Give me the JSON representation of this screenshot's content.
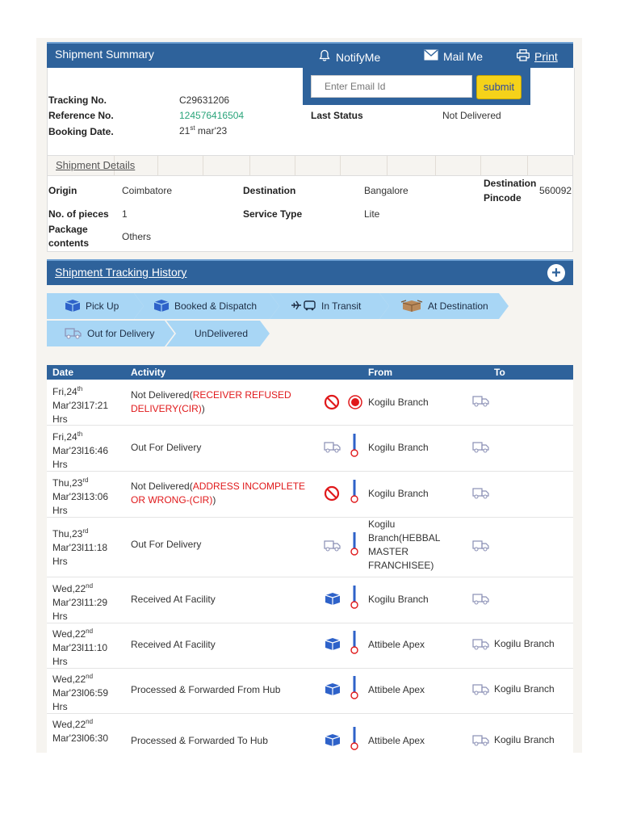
{
  "header": {
    "title": "Shipment Summary",
    "notify_label": "NotifyMe",
    "mail_label": "Mail Me",
    "print_label": "Print"
  },
  "email_popup": {
    "placeholder": "Enter Email Id",
    "submit_label": "submit"
  },
  "summary": {
    "tracking_label": "Tracking No.",
    "tracking_value": "C29631206",
    "reference_label": "Reference No.",
    "reference_value": "124576416504",
    "booking_label": "Booking Date.",
    "booking_day": "21",
    "booking_sup": "st",
    "booking_rest": " mar'23",
    "status_label": "Last Status",
    "status_value": "Not Delivered"
  },
  "details": {
    "section_title": "Shipment Details",
    "origin_label": "Origin",
    "origin_value": "Coimbatore",
    "destination_label": "Destination",
    "destination_value": "Bangalore",
    "pincode_label_1": "Destination",
    "pincode_label_2": "Pincode",
    "pincode_value": "560092",
    "pieces_label": "No. of pieces",
    "pieces_value": "1",
    "service_label": "Service Type",
    "service_value": "Lite",
    "contents_label_1": "Package",
    "contents_label_2": "contents",
    "contents_value": "Others"
  },
  "history": {
    "title": "Shipment Tracking History",
    "steps": [
      "Pick Up",
      "Booked & Dispatch",
      "In Transit",
      "At Destination",
      "Out for Delivery",
      "UnDelivered"
    ]
  },
  "table": {
    "headers": [
      "Date",
      "Activity",
      "From",
      "To"
    ],
    "rows": [
      {
        "d1": "Fri,24",
        "sup": "th",
        "d2": "Mar'23l17:21",
        "d3": "Hrs",
        "act": "Not Delivered(",
        "act_red": "RECEIVER REFUSED DELIVERY(CIR)",
        "act_end": ")",
        "from": "Kogilu Branch",
        "to": ""
      },
      {
        "d1": "Fri,24",
        "sup": "th",
        "d2": "Mar'23l16:46",
        "d3": "Hrs",
        "act": "Out For Delivery",
        "act_red": "",
        "act_end": "",
        "from": "Kogilu Branch",
        "to": ""
      },
      {
        "d1": "Thu,23",
        "sup": "rd",
        "d2": "Mar'23l13:06",
        "d3": "Hrs",
        "act": "Not Delivered(",
        "act_red": "ADDRESS INCOMPLETE OR WRONG-(CIR)",
        "act_end": ")",
        "from": "Kogilu Branch",
        "to": ""
      },
      {
        "d1": "Thu,23",
        "sup": "rd",
        "d2": "Mar'23l11:18",
        "d3": "Hrs",
        "act": "Out For Delivery",
        "act_red": "",
        "act_end": "",
        "from": "Kogilu Branch(HEBBAL MASTER FRANCHISEE)",
        "to": ""
      },
      {
        "d1": "Wed,22",
        "sup": "nd",
        "d2": "Mar'23l11:29",
        "d3": "Hrs",
        "act": "Received At Facility",
        "act_red": "",
        "act_end": "",
        "from": "Kogilu Branch",
        "to": ""
      },
      {
        "d1": "Wed,22",
        "sup": "nd",
        "d2": "Mar'23l11:10",
        "d3": "Hrs",
        "act": "Received At Facility",
        "act_red": "",
        "act_end": "",
        "from": "Attibele Apex",
        "to": "Kogilu Branch"
      },
      {
        "d1": "Wed,22",
        "sup": "nd",
        "d2": "Mar'23l06:59",
        "d3": "Hrs",
        "act": "Processed & Forwarded From Hub",
        "act_red": "",
        "act_end": "",
        "from": "Attibele Apex",
        "to": "Kogilu Branch"
      },
      {
        "d1": "Wed,22",
        "sup": "nd",
        "d2": "Mar'23l06:30",
        "d3": "",
        "act": "Processed & Forwarded To Hub",
        "act_red": "",
        "act_end": "",
        "from": "Attibele Apex",
        "to": "Kogilu Branch"
      }
    ]
  },
  "colors": {
    "header_blue": "#2e629b",
    "step_blue": "#a8d6f5",
    "status_red": "#e0191b",
    "reference_green": "#2aa47a",
    "submit_yellow": "#f5d21a"
  }
}
